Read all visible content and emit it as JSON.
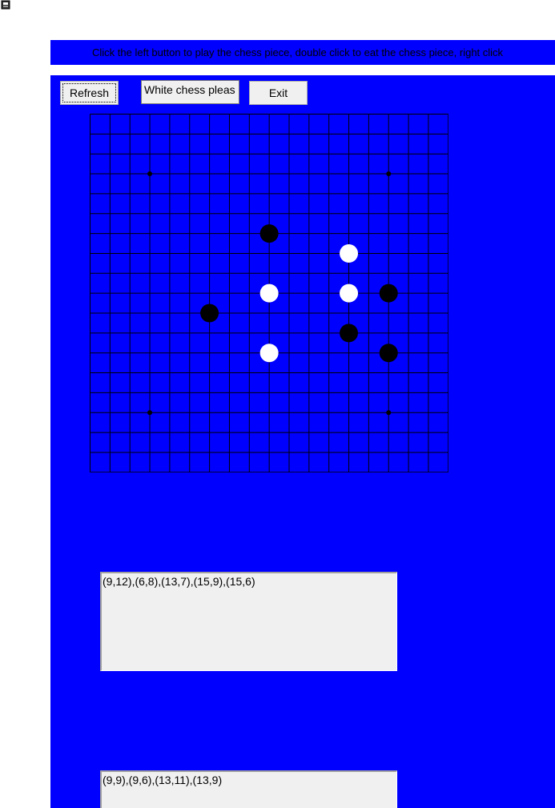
{
  "window": {
    "icon": "app-window-icon"
  },
  "instruction": {
    "text": "Click the left button to play the chess piece, double click to eat the chess piece, right click"
  },
  "toolbar": {
    "refresh_label": "Refresh",
    "status_value": "White chess pleas",
    "exit_label": "Exit"
  },
  "board": {
    "size": 19,
    "line_color": "#000000",
    "background": "#0000ff",
    "star_points": [
      [
        3,
        3
      ],
      [
        15,
        3
      ],
      [
        3,
        15
      ],
      [
        15,
        15
      ]
    ],
    "black_stones": [
      [
        9,
        6
      ],
      [
        6,
        10
      ],
      [
        15,
        9
      ],
      [
        13,
        11
      ],
      [
        15,
        12
      ]
    ],
    "white_stones": [
      [
        13,
        7
      ],
      [
        9,
        9
      ],
      [
        13,
        9
      ],
      [
        9,
        12
      ]
    ]
  },
  "logs": {
    "top": "(9,12),(6,8),(13,7),(15,9),(15,6)",
    "bottom": "(9,9),(9,6),(13,11),(13,9)"
  },
  "colors": {
    "accent": "#0000ff",
    "button_bg": "#f0f0f0"
  }
}
